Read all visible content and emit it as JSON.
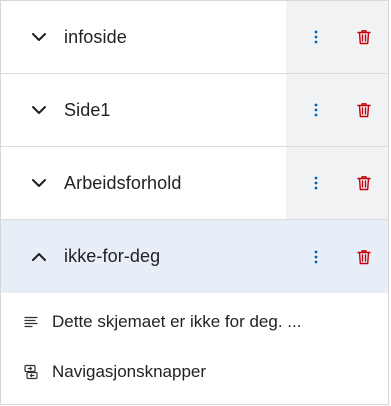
{
  "pages": [
    {
      "label": "infoside",
      "expanded": false
    },
    {
      "label": "Side1",
      "expanded": false
    },
    {
      "label": "Arbeidsforhold",
      "expanded": false
    },
    {
      "label": "ikke-for-deg",
      "expanded": true
    }
  ],
  "children": [
    {
      "label": "Dette skjemaet er ikke for deg. ...",
      "icon": "paragraph-icon"
    },
    {
      "label": "Navigasjonsknapper",
      "icon": "navigation-buttons-icon"
    }
  ],
  "colors": {
    "delete_icon": "#c3000a",
    "action_icon": "#0062ba",
    "expanded_row_bg": "#e7eef8",
    "actions_bg": "#f1f2f4"
  }
}
